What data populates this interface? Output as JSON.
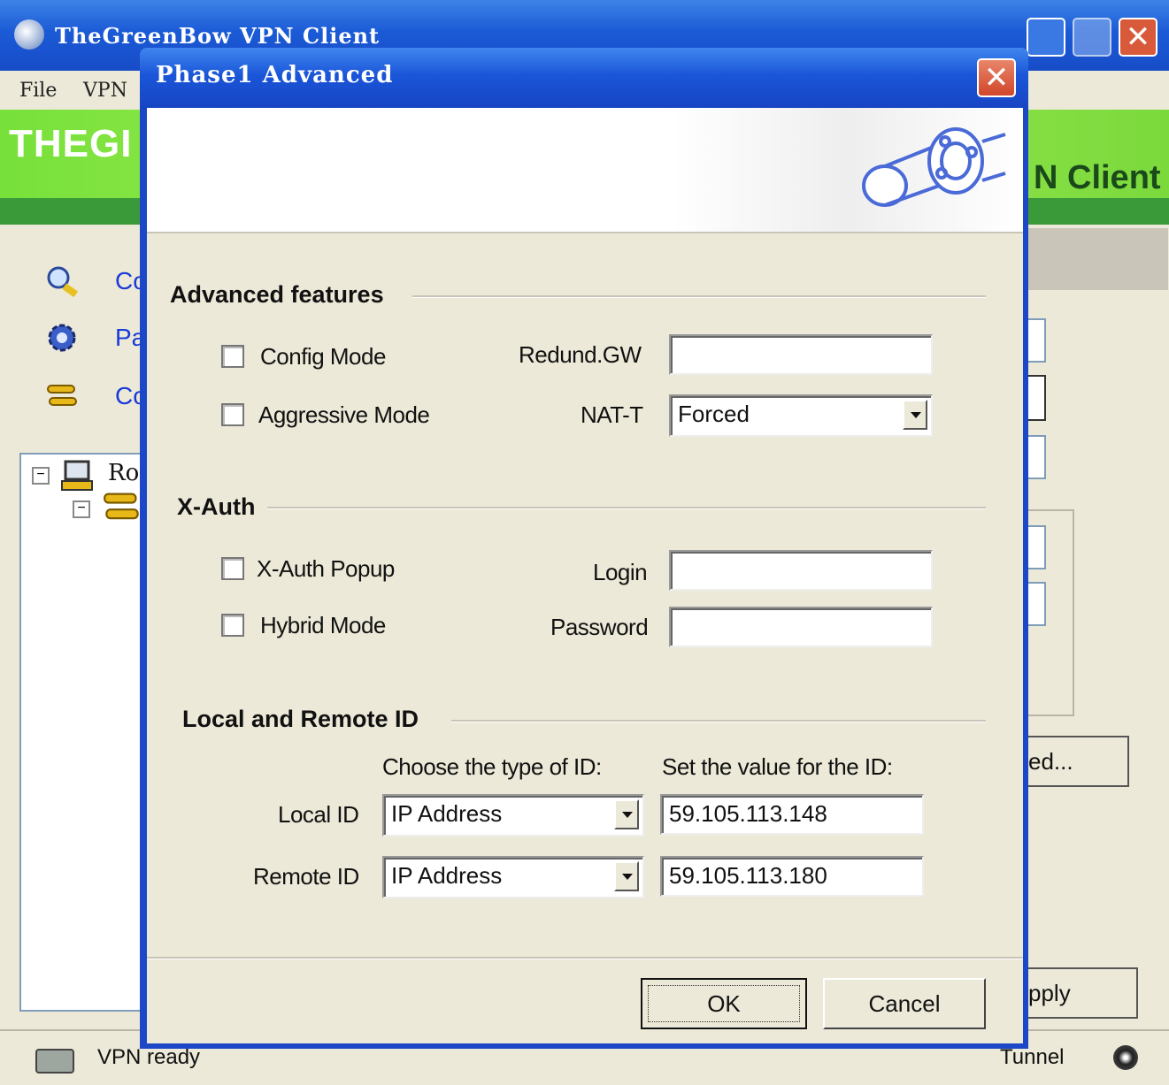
{
  "main_window": {
    "title": "TheGreenBow VPN Client",
    "menu": [
      "File",
      "VPN"
    ],
    "brand_left": "THEGI",
    "brand_right": "N Client",
    "sidebar": [
      {
        "label": "Co",
        "icon": "magnifier-console-icon"
      },
      {
        "label": "Pa",
        "icon": "gear-icon"
      },
      {
        "label": "Co",
        "icon": "keys-icon"
      }
    ],
    "tree": {
      "root_label": "Ro"
    },
    "advanced_button_partial": "ed...",
    "apply_button_partial": "pply",
    "status": {
      "text": "VPN ready",
      "right": "Tunnel"
    }
  },
  "dialog": {
    "title": "Phase1 Advanced",
    "advanced_features": {
      "title": "Advanced features",
      "config_mode": {
        "label": "Config Mode",
        "checked": false
      },
      "aggressive_mode": {
        "label": "Aggressive Mode",
        "checked": false
      },
      "redund_gw": {
        "label": "Redund.GW",
        "value": ""
      },
      "nat_t": {
        "label": "NAT-T",
        "value": "Forced"
      }
    },
    "xauth": {
      "title": "X-Auth",
      "popup": {
        "label": "X-Auth Popup",
        "checked": false
      },
      "hybrid": {
        "label": "Hybrid Mode",
        "checked": false
      },
      "login": {
        "label": "Login",
        "value": ""
      },
      "password": {
        "label": "Password",
        "value": ""
      }
    },
    "ids": {
      "title": "Local and Remote ID",
      "type_header": "Choose the type of ID:",
      "value_header": "Set the value for the ID:",
      "local": {
        "label": "Local ID",
        "type": "IP Address",
        "value": "59.105.113.148"
      },
      "remote": {
        "label": "Remote ID",
        "type": "IP Address",
        "value": "59.105.113.180"
      }
    },
    "buttons": {
      "ok": "OK",
      "cancel": "Cancel"
    }
  }
}
